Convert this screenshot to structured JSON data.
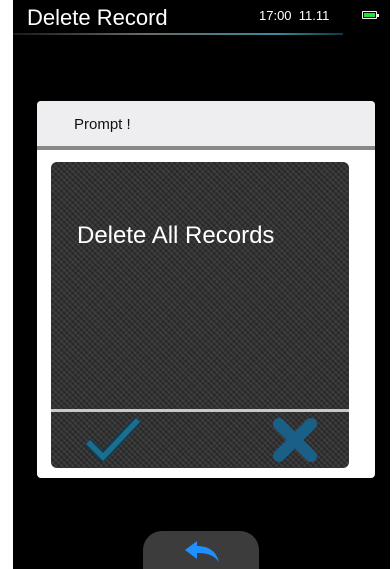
{
  "status_bar": {
    "title": "Delete Record",
    "time": "17:00",
    "date": "11.11",
    "battery_icon": "battery-icon",
    "battery_level": 1.0
  },
  "dialog": {
    "title": "Prompt !",
    "message": "Delete All Records",
    "confirm_icon": "checkmark-icon",
    "cancel_icon": "close-icon"
  },
  "footer": {
    "back_icon": "back-arrow-icon"
  },
  "colors": {
    "background": "#000000",
    "dialog_header": "#eeedf0",
    "panel": "#2f2f2f",
    "confirm_accent": "#1d6e8e",
    "cancel_accent": "#1a5f85",
    "back_accent": "#1e90ff",
    "battery": "#22e034"
  }
}
